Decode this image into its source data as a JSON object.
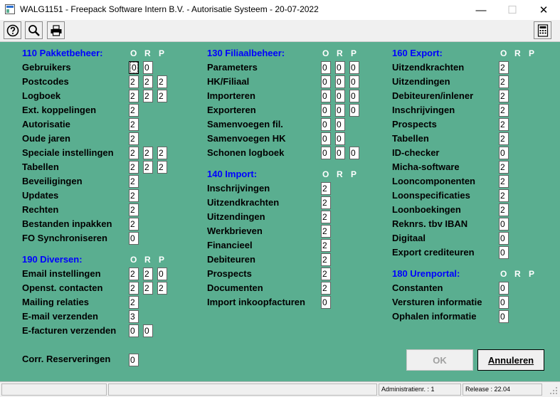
{
  "window": {
    "title": "WALG1151  -  Freepack Software Intern B.V.  -  Autorisatie Systeem  -  20-07-2022",
    "minimize": "—",
    "maximize": "☐",
    "close": "✕"
  },
  "toolbar": {
    "icons": [
      "help-icon",
      "search-icon",
      "print-icon",
      "calculator-icon"
    ]
  },
  "columns": {
    "o": "O",
    "r": "R",
    "p": "P"
  },
  "sections": {
    "pakketbeheer": {
      "title": "110 Pakketbeheer:",
      "rows": [
        {
          "label": "Gebruikers",
          "values": [
            "0",
            "0"
          ]
        },
        {
          "label": "Postcodes",
          "values": [
            "2",
            "2",
            "2"
          ]
        },
        {
          "label": "Logboek",
          "values": [
            "2",
            "2",
            "2"
          ]
        },
        {
          "label": "Ext. koppelingen",
          "values": [
            "2"
          ]
        },
        {
          "label": "Autorisatie",
          "values": [
            "2"
          ]
        },
        {
          "label": "Oude jaren",
          "values": [
            "2"
          ]
        },
        {
          "label": "Speciale instellingen",
          "values": [
            "2",
            "2",
            "2"
          ]
        },
        {
          "label": "Tabellen",
          "values": [
            "2",
            "2",
            "2"
          ]
        },
        {
          "label": "Beveiligingen",
          "values": [
            "2"
          ]
        },
        {
          "label": "Updates",
          "values": [
            "2"
          ]
        },
        {
          "label": "Rechten",
          "values": [
            "2"
          ]
        },
        {
          "label": "Bestanden inpakken",
          "values": [
            "2"
          ]
        },
        {
          "label": "FO Synchroniseren",
          "values": [
            "0"
          ]
        }
      ]
    },
    "diversen": {
      "title": "190 Diversen:",
      "rows": [
        {
          "label": "Email instellingen",
          "values": [
            "2",
            "2",
            "0"
          ]
        },
        {
          "label": "Openst. contacten",
          "values": [
            "2",
            "2",
            "2"
          ]
        },
        {
          "label": "Mailing relaties",
          "values": [
            "2"
          ]
        },
        {
          "label": "E-mail verzenden",
          "values": [
            "3"
          ]
        },
        {
          "label": "E-facturen verzenden",
          "values": [
            "0",
            "0"
          ]
        }
      ]
    },
    "reserveringen": {
      "label": "Corr. Reserveringen",
      "value": "0"
    },
    "filiaalbeheer": {
      "title": "130 Filiaalbeheer:",
      "rows": [
        {
          "label": "Parameters",
          "values": [
            "0",
            "0",
            "0"
          ]
        },
        {
          "label": "HK/Filiaal",
          "values": [
            "0",
            "0",
            "0"
          ]
        },
        {
          "label": "Importeren",
          "values": [
            "0",
            "0",
            "0"
          ]
        },
        {
          "label": "Exporteren",
          "values": [
            "0",
            "0",
            "0"
          ]
        },
        {
          "label": "Samenvoegen fil.",
          "values": [
            "0",
            "0"
          ]
        },
        {
          "label": "Samenvoegen HK",
          "values": [
            "0",
            "0"
          ]
        },
        {
          "label": "Schonen logboek",
          "values": [
            "0",
            "0",
            "0"
          ]
        }
      ]
    },
    "import": {
      "title": "140 Import:",
      "rows": [
        {
          "label": "Inschrijvingen",
          "values": [
            "2"
          ]
        },
        {
          "label": "Uitzendkrachten",
          "values": [
            "2"
          ]
        },
        {
          "label": "Uitzendingen",
          "values": [
            "2"
          ]
        },
        {
          "label": "Werkbrieven",
          "values": [
            "2"
          ]
        },
        {
          "label": "Financieel",
          "values": [
            "2"
          ]
        },
        {
          "label": "Debiteuren",
          "values": [
            "2"
          ]
        },
        {
          "label": "Prospects",
          "values": [
            "2"
          ]
        },
        {
          "label": "Documenten",
          "values": [
            "2"
          ]
        },
        {
          "label": "Import inkoopfacturen",
          "values": [
            "0"
          ]
        }
      ]
    },
    "export": {
      "title": "160 Export:",
      "rows": [
        {
          "label": "Uitzendkrachten",
          "values": [
            "2"
          ]
        },
        {
          "label": "Uitzendingen",
          "values": [
            "2"
          ]
        },
        {
          "label": "Debiteuren/inlener",
          "values": [
            "2"
          ]
        },
        {
          "label": "Inschrijvingen",
          "values": [
            "2"
          ]
        },
        {
          "label": "Prospects",
          "values": [
            "2"
          ]
        },
        {
          "label": "Tabellen",
          "values": [
            "2"
          ]
        },
        {
          "label": "ID-checker",
          "values": [
            "0"
          ]
        },
        {
          "label": "Micha-software",
          "values": [
            "2"
          ]
        },
        {
          "label": "Looncomponenten",
          "values": [
            "2"
          ]
        },
        {
          "label": "Loonspecificaties",
          "values": [
            "2"
          ]
        },
        {
          "label": "Loonboekingen",
          "values": [
            "2"
          ]
        },
        {
          "label": "Reknrs. tbv IBAN",
          "values": [
            "0"
          ]
        },
        {
          "label": "Digitaal",
          "values": [
            "0"
          ]
        },
        {
          "label": "Export crediteuren",
          "values": [
            "0"
          ]
        }
      ]
    },
    "urenportal": {
      "title": "180 Urenportal:",
      "rows": [
        {
          "label": "Constanten",
          "values": [
            "0"
          ]
        },
        {
          "label": "Versturen informatie",
          "values": [
            "0"
          ]
        },
        {
          "label": "Ophalen informatie",
          "values": [
            "0"
          ]
        }
      ]
    }
  },
  "buttons": {
    "ok": "OK",
    "cancel": "Annuleren"
  },
  "status": {
    "admin": "Administratienr. :    1",
    "release": "Release : 22.04"
  }
}
